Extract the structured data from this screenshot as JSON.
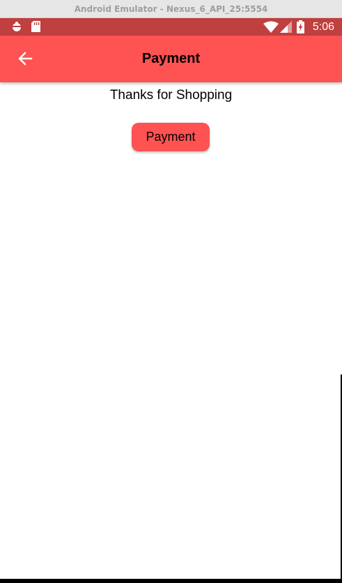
{
  "window": {
    "title": "Android Emulator - Nexus_6_API_25:5554"
  },
  "status_bar": {
    "left_icons": [
      "notification-icon",
      "sd-card-icon"
    ],
    "right_icons": [
      "wifi-icon",
      "signal-icon",
      "battery-charging-icon"
    ],
    "time": "5:06",
    "color": "#c03f3f"
  },
  "app_bar": {
    "title": "Payment",
    "back_icon": "arrow-back-icon",
    "color": "#ff5252"
  },
  "content": {
    "message": "Thanks for Shopping",
    "button_label": "Payment",
    "button_color": "#ff5252"
  }
}
